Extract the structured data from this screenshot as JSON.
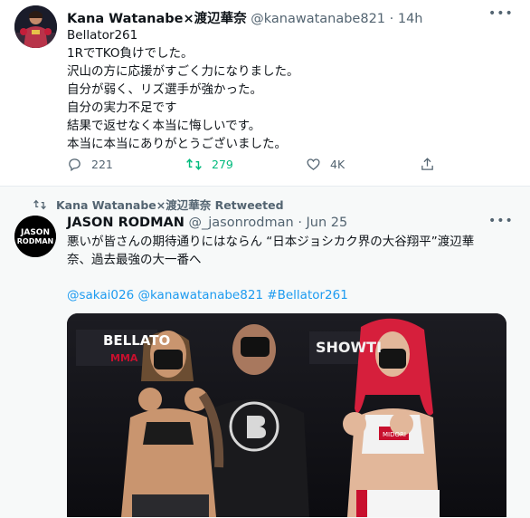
{
  "tweet1": {
    "name": "Kana Watanabe×渡辺華奈",
    "handle": "@kanawatanabe821",
    "time": "· 14h",
    "more": "•••",
    "lines": [
      "Bellator261",
      "1RでTKO負けでした。",
      "沢山の方に応援がすごく力になりました。",
      "自分が弱く、リズ選手が強かった。",
      "自分の実力不足です",
      "結果で返せなく本当に悔しいです。",
      "本当に本当にありがとうございました。"
    ],
    "actions": {
      "replies": "221",
      "retweets": "279",
      "likes": "4K"
    },
    "colors": {
      "retweet_active": "#00ba7c",
      "muted": "#536471"
    },
    "avatar_icon": "user-photo-icon"
  },
  "tweet2": {
    "retweeted_by": "Kana Watanabe×渡辺華奈 Retweeted",
    "name": "JASON RODMAN",
    "handle": "@_jasonrodman",
    "time": "· Jun 25",
    "more": "•••",
    "lines": [
      "悪いが皆さんの期待通りにはならん “日本ジョシカク界の大谷翔平”渡辺華",
      "奈、過去最強の大一番へ"
    ],
    "links": "@sakai026 @kanawatanabe821 #Bellator261",
    "avatar_text": [
      "JASON",
      "RODMAN"
    ],
    "photo": {
      "banner_left": "BELLATO",
      "banner_left_sub": "MMA",
      "banner_right": "SHOWTI",
      "center_logo": "B",
      "shorts_text": "MIDORI"
    },
    "colors": {
      "link": "#1d9bf0"
    }
  }
}
